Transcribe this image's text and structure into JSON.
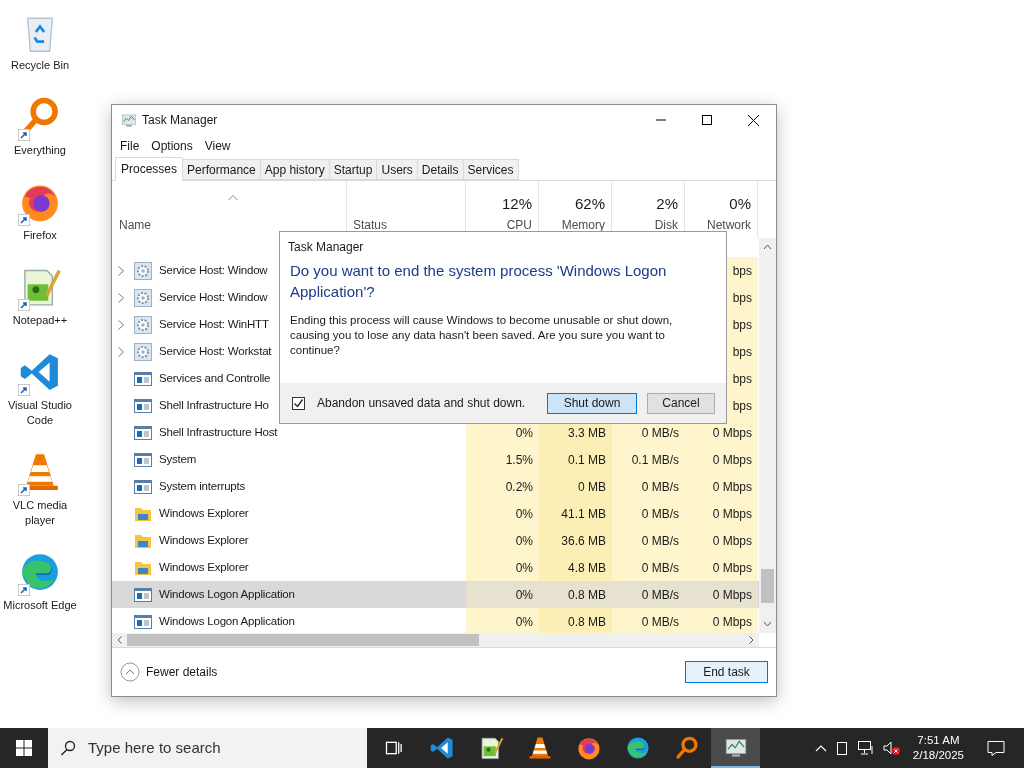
{
  "desktop_icons": [
    {
      "label": "Recycle Bin",
      "kind": "recycle",
      "shortcut": false
    },
    {
      "label": "Everything",
      "kind": "everything",
      "shortcut": true
    },
    {
      "label": "Firefox",
      "kind": "firefox",
      "shortcut": true
    },
    {
      "label": "Notepad++",
      "kind": "notepadpp",
      "shortcut": true
    },
    {
      "label": "Visual Studio Code",
      "kind": "vscode",
      "shortcut": true
    },
    {
      "label": "VLC media player",
      "kind": "vlc",
      "shortcut": true
    },
    {
      "label": "Microsoft Edge",
      "kind": "edge",
      "shortcut": true
    }
  ],
  "window": {
    "title": "Task Manager",
    "menu": [
      "File",
      "Options",
      "View"
    ],
    "tabs": [
      {
        "label": "Processes",
        "selected": true
      },
      {
        "label": "Performance",
        "selected": false
      },
      {
        "label": "App history",
        "selected": false
      },
      {
        "label": "Startup",
        "selected": false
      },
      {
        "label": "Users",
        "selected": false
      },
      {
        "label": "Details",
        "selected": false
      },
      {
        "label": "Services",
        "selected": false
      }
    ],
    "columns": [
      {
        "label": "Name",
        "kind": "name"
      },
      {
        "label": "Status",
        "kind": "text"
      },
      {
        "percent": "12%",
        "label": "CPU",
        "kind": "usage"
      },
      {
        "percent": "62%",
        "label": "Memory",
        "kind": "usage"
      },
      {
        "percent": "2%",
        "label": "Disk",
        "kind": "usage"
      },
      {
        "percent": "0%",
        "label": "Network",
        "kind": "usage"
      }
    ],
    "rows": [
      {
        "name": "Service Host: Window",
        "kind": "gear",
        "expandable": true,
        "selected": false,
        "network": "bps"
      },
      {
        "name": "Service Host: Window",
        "kind": "gear",
        "expandable": true,
        "selected": false,
        "network": "bps"
      },
      {
        "name": "Service Host: WinHTT",
        "kind": "gear",
        "expandable": true,
        "selected": false,
        "network": "bps"
      },
      {
        "name": "Service Host: Workstat",
        "kind": "gear",
        "expandable": true,
        "selected": false,
        "network": "bps"
      },
      {
        "name": "Services and Controlle",
        "kind": "app",
        "expandable": false,
        "selected": false,
        "network": "bps"
      },
      {
        "name": "Shell Infrastructure Ho",
        "kind": "app",
        "expandable": false,
        "selected": false,
        "network": "bps"
      },
      {
        "name": "Shell Infrastructure Host",
        "kind": "app",
        "expandable": false,
        "selected": false,
        "cpu": "0%",
        "memory": "3.3 MB",
        "disk": "0 MB/s",
        "network": "0 Mbps"
      },
      {
        "name": "System",
        "kind": "app",
        "expandable": false,
        "selected": false,
        "cpu": "1.5%",
        "memory": "0.1 MB",
        "disk": "0.1 MB/s",
        "network": "0 Mbps"
      },
      {
        "name": "System interrupts",
        "kind": "app",
        "expandable": false,
        "selected": false,
        "cpu": "0.2%",
        "memory": "0 MB",
        "disk": "0 MB/s",
        "network": "0 Mbps"
      },
      {
        "name": "Windows Explorer",
        "kind": "folder",
        "expandable": false,
        "selected": false,
        "cpu": "0%",
        "memory": "41.1 MB",
        "disk": "0 MB/s",
        "network": "0 Mbps"
      },
      {
        "name": "Windows Explorer",
        "kind": "folder",
        "expandable": false,
        "selected": false,
        "cpu": "0%",
        "memory": "36.6 MB",
        "disk": "0 MB/s",
        "network": "0 Mbps"
      },
      {
        "name": "Windows Explorer",
        "kind": "folder",
        "expandable": false,
        "selected": false,
        "cpu": "0%",
        "memory": "4.8 MB",
        "disk": "0 MB/s",
        "network": "0 Mbps"
      },
      {
        "name": "Windows Logon Application",
        "kind": "app",
        "expandable": false,
        "selected": true,
        "cpu": "0%",
        "memory": "0.8 MB",
        "disk": "0 MB/s",
        "network": "0 Mbps"
      },
      {
        "name": "Windows Logon Application",
        "kind": "app",
        "expandable": false,
        "selected": false,
        "cpu": "0%",
        "memory": "0.8 MB",
        "disk": "0 MB/s",
        "network": "0 Mbps"
      }
    ],
    "footer": {
      "toggle": "Fewer details",
      "button": "End task"
    }
  },
  "dialog": {
    "title": "Task Manager",
    "heading": "Do you want to end the system process 'Windows Logon Application'?",
    "message": "Ending this process will cause Windows to become unusable or shut down, causing you to lose any data hasn't been saved. Are you sure you want to continue?",
    "checkbox": {
      "label": "Abandon unsaved data and shut down.",
      "checked": true
    },
    "buttons": [
      {
        "label": "Shut down",
        "default": true
      },
      {
        "label": "Cancel",
        "default": false
      }
    ]
  },
  "taskbar": {
    "search_placeholder": "Type here to search",
    "apps": [
      {
        "kind": "taskview",
        "active": false
      },
      {
        "kind": "vscode",
        "active": false
      },
      {
        "kind": "notepadpp",
        "active": false
      },
      {
        "kind": "vlc",
        "active": false
      },
      {
        "kind": "firefox",
        "active": false
      },
      {
        "kind": "edge",
        "active": false
      },
      {
        "kind": "everything",
        "active": false
      },
      {
        "kind": "taskmgr",
        "active": true
      }
    ],
    "time": "7:51 AM",
    "date": "2/18/2025"
  }
}
